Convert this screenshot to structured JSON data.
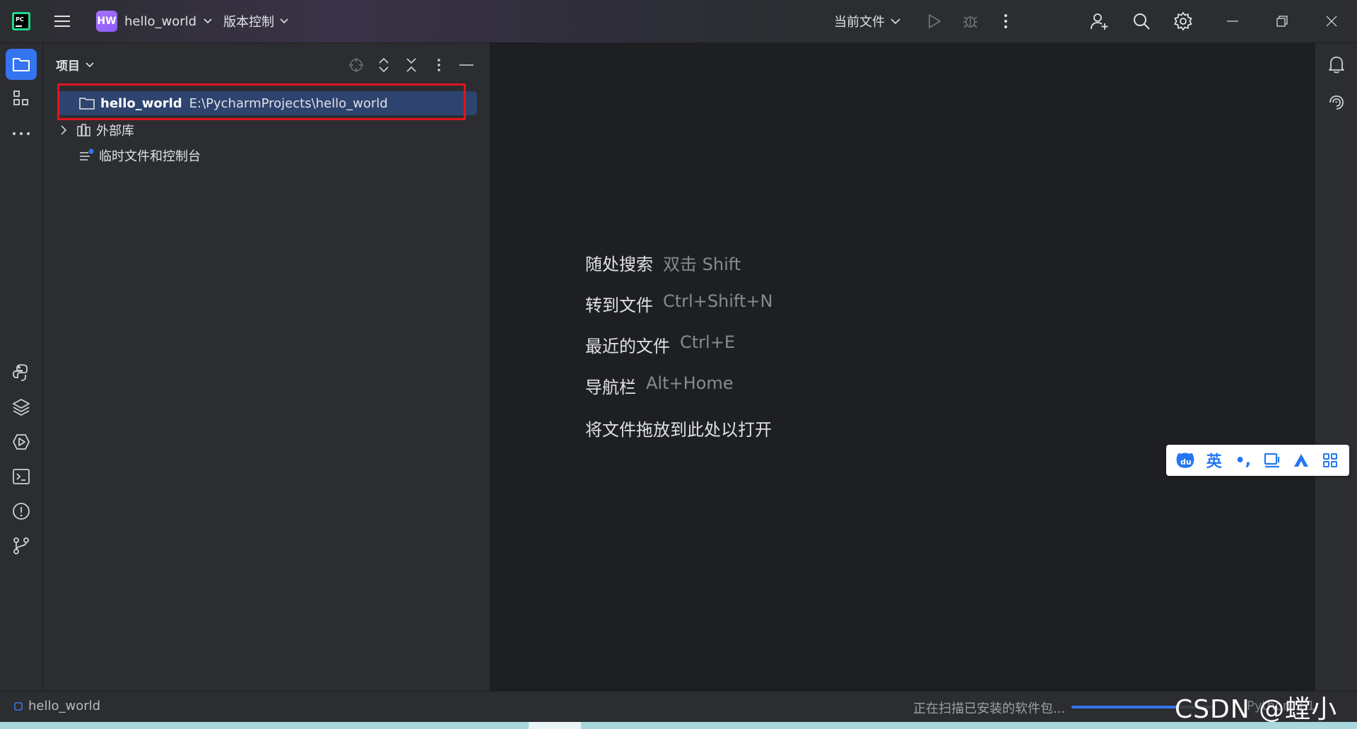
{
  "titlebar": {
    "project_badge": "HW",
    "project_name": "hello_world",
    "vcs_label": "版本控制",
    "run_config_label": "当前文件"
  },
  "project_panel": {
    "title": "项目",
    "tree": {
      "root_name": "hello_world",
      "root_path": "E:\\PycharmProjects\\hello_world",
      "external_libraries": "外部库",
      "scratches": "临时文件和控制台"
    }
  },
  "editor": {
    "hints": [
      {
        "label": "随处搜索",
        "key": "双击 Shift"
      },
      {
        "label": "转到文件",
        "key": "Ctrl+Shift+N"
      },
      {
        "label": "最近的文件",
        "key": "Ctrl+E"
      },
      {
        "label": "导航栏",
        "key": "Alt+Home"
      },
      {
        "label": "将文件拖放到此处以打开",
        "key": ""
      }
    ]
  },
  "ime": {
    "lang": "英",
    "punct": "•,"
  },
  "statusbar": {
    "breadcrumb": "hello_world",
    "status_text": "正在扫描已安装的软件包...",
    "progress_fraction": 0.75,
    "progress_text": "Python 3.1"
  },
  "watermark": "CSDN @螳小蜂",
  "colors": {
    "accent": "#3574f0",
    "selection": "#2e436e",
    "highlight_box": "#e0161e",
    "project_badge": "#a772ff"
  }
}
